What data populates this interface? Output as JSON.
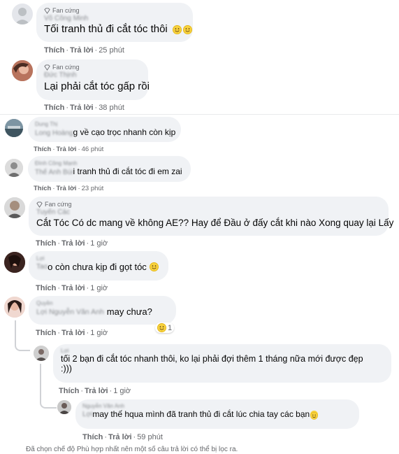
{
  "fan_badge": "Fan cứng",
  "action_like": "Thích",
  "action_reply": "Trả lời",
  "comments": [
    {
      "name": "Võ Công Minh",
      "text": "Tối tranh thủ đi cắt tóc thôi",
      "emoji": "grinning-sweat-emoji ×2",
      "time": "25 phút"
    },
    {
      "name": "Đức Thịnh",
      "text": "Lại phải cắt tóc gấp rồi",
      "time": "38 phút"
    },
    {
      "name_line1": "Dung Thị",
      "name_line2": "Long Hoàng",
      "text": "g về cạo trọc nhanh còn kịp",
      "time": "46 phút"
    },
    {
      "name_line1": "Đình Công Mạnh",
      "name_line2": "Thế Anh Bùi",
      "text": "i tranh thủ đi cắt tóc đi em zai",
      "time": "23 phút"
    },
    {
      "name": "Tuyến Các",
      "text": "Cắt Tóc Có dc mang về không AE?? Hay để Đầu ở đấy cắt khi nào Xong quay lại Lấy",
      "time": "1 giờ"
    },
    {
      "name_line1": "Lợi",
      "name_line2": "Tao",
      "text": "o còn chưa kịp đi gọt tóc",
      "time": "1 giờ"
    },
    {
      "name": "Quyền",
      "tag": "Lợi Nguyễn Văn Anh",
      "text": "may chưa?",
      "time": "1 giờ",
      "reaction_count": "1"
    },
    {
      "name": "Lợi",
      "text_line1": "tối 2 bạn đi cắt tóc nhanh thôi, ko lại phải đợi thêm 1 tháng nữa mới được đẹp",
      "text_line2": ":)))",
      "time": "1 giờ"
    },
    {
      "name": "Nguyễn Văn Anh",
      "name_line2": "Lợi",
      "text": "may thế hqua mình đã tranh thủ đi cắt lúc chia tay các bạn",
      "time": "59 phút"
    }
  ],
  "filter_note": "Đã chọn chế độ Phù hợp nhất nên một số câu trả lời có thể bị lọc ra.",
  "colors": {
    "bubble": "#f0f2f5",
    "meta": "#65676b",
    "text": "#050505",
    "emoji": "#f7d13d"
  }
}
